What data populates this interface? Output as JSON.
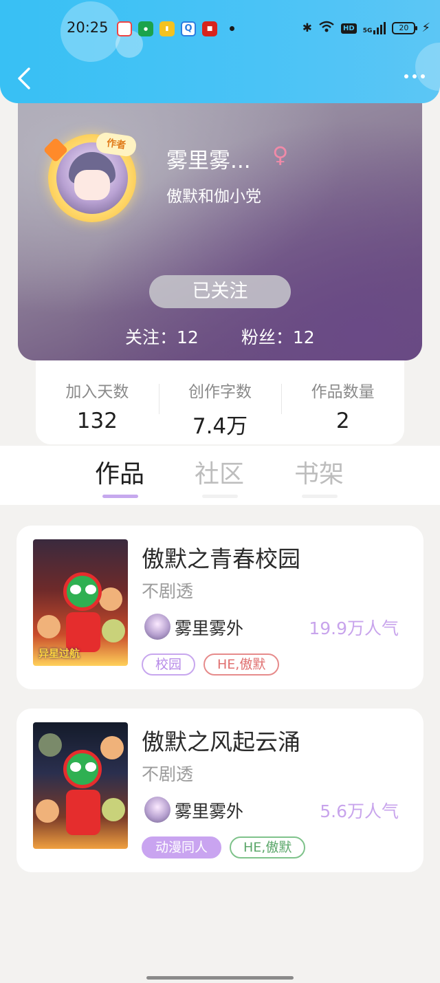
{
  "status_bar": {
    "time": "20:25",
    "notification_icons": [
      "wallet-app-icon",
      "oppo-app-icon",
      "reader-app-icon",
      "browser-app-icon",
      "news-app-icon"
    ],
    "hd_label": "HD",
    "network_label": "5G",
    "battery_level": "20"
  },
  "nav": {
    "back_icon": "chevron-left-icon",
    "more_icon": "more-dots-icon"
  },
  "profile": {
    "author_badge": "作者",
    "username": "雾里雾...",
    "gender_symbol": "♀",
    "signature": "傲默和伽小党",
    "follow_button": "已关注",
    "following_text": "关注：12",
    "followers_text": "粉丝：12"
  },
  "stats": [
    {
      "label": "加入天数",
      "value": "132"
    },
    {
      "label": "创作字数",
      "value": "7.4万"
    },
    {
      "label": "作品数量",
      "value": "2"
    }
  ],
  "tabs": [
    {
      "label": "作品",
      "active": true
    },
    {
      "label": "社区",
      "active": false
    },
    {
      "label": "书架",
      "active": false
    }
  ],
  "works": [
    {
      "title": "傲默之青春校园",
      "subtitle": "不剧透",
      "author": "雾里雾外",
      "popularity": "19.9万人气",
      "cover_text": "异星过航",
      "tags": [
        "校园",
        "HE,傲默"
      ]
    },
    {
      "title": "傲默之风起云涌",
      "subtitle": "不剧透",
      "author": "雾里雾外",
      "popularity": "5.6万人气",
      "tags": [
        "动漫同人",
        "HE,傲默"
      ]
    }
  ]
}
